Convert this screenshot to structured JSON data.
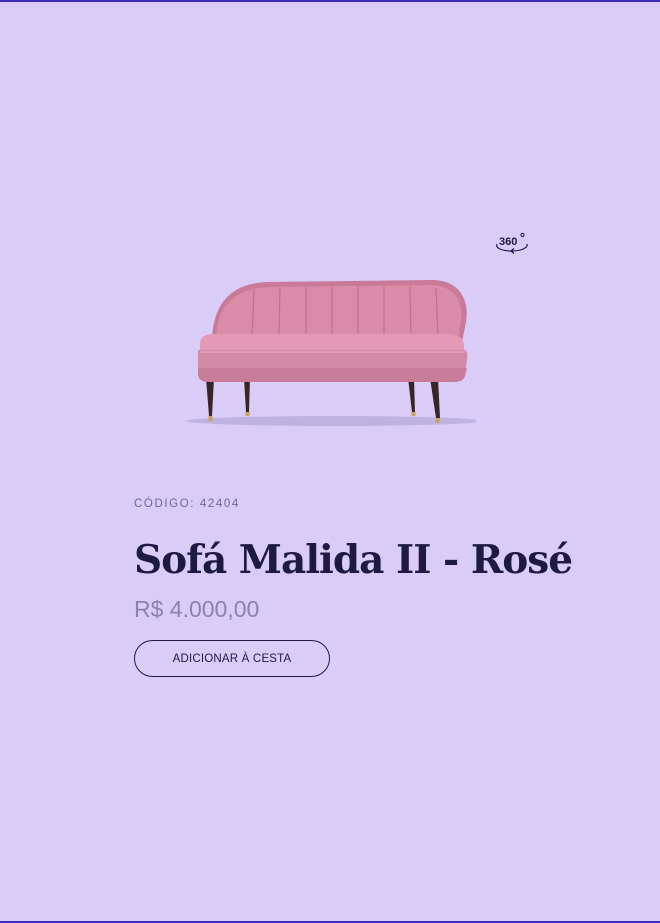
{
  "product": {
    "code_label": "CÓDIGO: 42404",
    "name": "Sofá Malida II - Rosé",
    "price": "R$ 4.000,00",
    "image_alt": "pink-velvet-sofa-image"
  },
  "actions": {
    "add_to_cart_label": "ADICIONAR À CESTA"
  },
  "viewer": {
    "rotate_icon": "rotate-360-icon",
    "rotate_label": "360"
  },
  "colors": {
    "background": "#d9cdf8",
    "text_dark": "#1e1a42",
    "price_gray": "#8a84a8",
    "sofa_pink": "#d98ba7",
    "accent": "#3b2db8"
  }
}
